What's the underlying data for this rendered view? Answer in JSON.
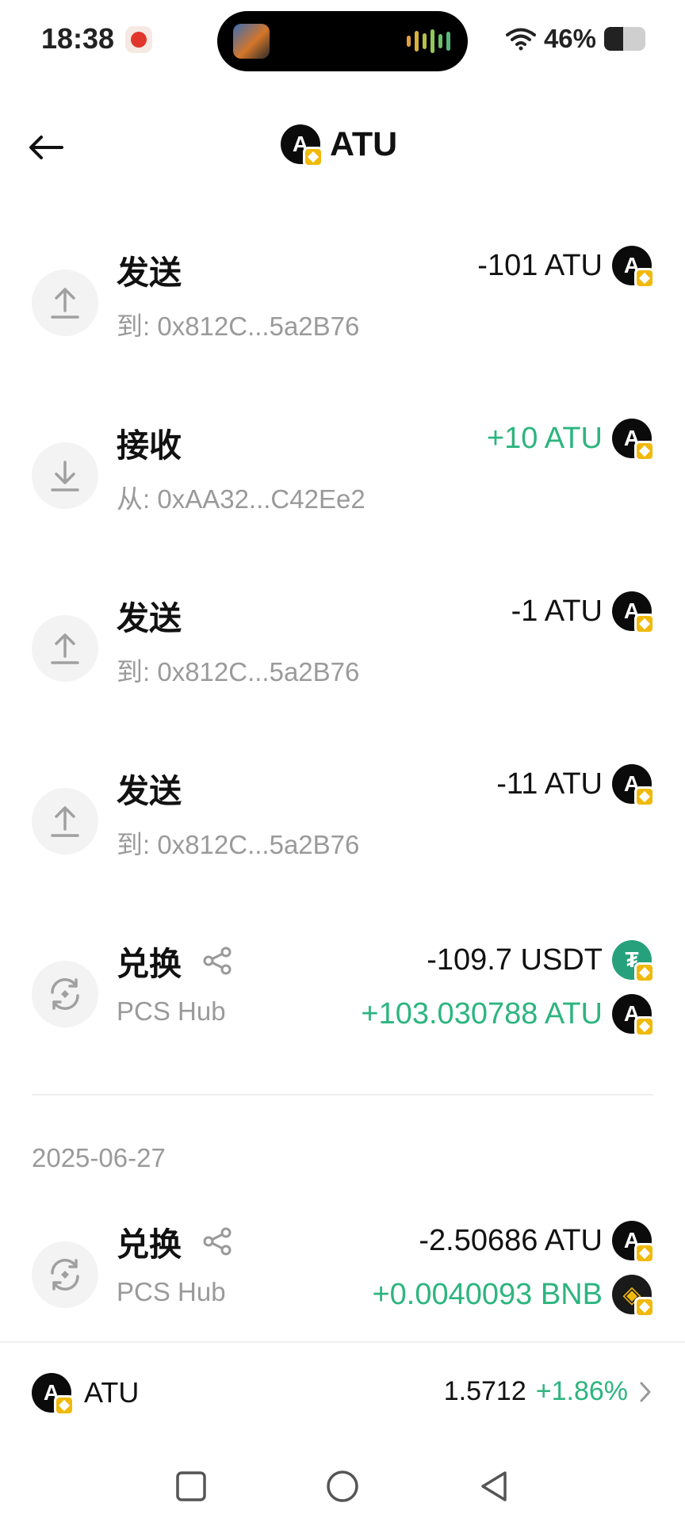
{
  "status_bar": {
    "time": "18:38",
    "battery_text": "46%",
    "battery_level": 0.46,
    "icons": [
      "app-notification-icon",
      "wifi-icon",
      "battery-icon"
    ]
  },
  "header": {
    "title": "ATU",
    "icon": "arrow-left-icon"
  },
  "transactions": [
    {
      "type": "send",
      "title": "发送",
      "subtitle": "到: 0x812C...5a2B76",
      "amounts": [
        {
          "text": "-101 ATU",
          "token": "ATU",
          "positive": false
        }
      ]
    },
    {
      "type": "receive",
      "title": "接收",
      "subtitle": "从: 0xAA32...C42Ee2",
      "amounts": [
        {
          "text": "+10 ATU",
          "token": "ATU",
          "positive": true
        }
      ]
    },
    {
      "type": "send",
      "title": "发送",
      "subtitle": "到: 0x812C...5a2B76",
      "amounts": [
        {
          "text": "-1 ATU",
          "token": "ATU",
          "positive": false
        }
      ]
    },
    {
      "type": "send",
      "title": "发送",
      "subtitle": "到: 0x812C...5a2B76",
      "amounts": [
        {
          "text": "-11 ATU",
          "token": "ATU",
          "positive": false
        }
      ]
    },
    {
      "type": "swap",
      "title": "兑换",
      "subtitle": "PCS Hub",
      "amounts": [
        {
          "text": "-109.7 USDT",
          "token": "USDT",
          "positive": false
        },
        {
          "text": "+103.030788 ATU",
          "token": "ATU",
          "positive": true
        }
      ]
    }
  ],
  "date_group": {
    "date": "2025-06-27",
    "transactions": [
      {
        "type": "swap",
        "title": "兑换",
        "subtitle": "PCS Hub",
        "amounts": [
          {
            "text": "-2.50686 ATU",
            "token": "ATU",
            "positive": false
          },
          {
            "text": "+0.0040093 BNB",
            "token": "BNB",
            "positive": true
          }
        ]
      }
    ]
  },
  "bottom_bar": {
    "symbol": "ATU",
    "price": "1.5712",
    "change": "+1.86%"
  },
  "colors": {
    "positive": "#2db57f",
    "text": "#111111",
    "muted": "#9a9a9a",
    "bnb_badge": "#f0b90b"
  }
}
